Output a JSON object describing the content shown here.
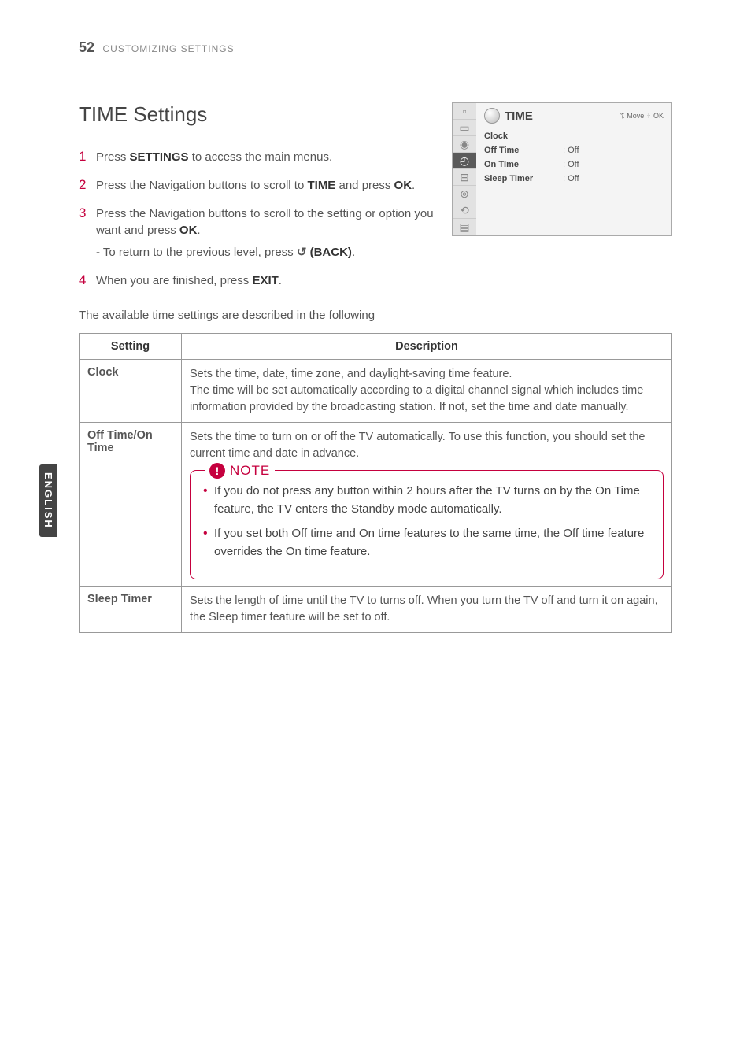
{
  "header": {
    "page_number": "52",
    "section": "CUSTOMIZING SETTINGS"
  },
  "heading": "TIME Settings",
  "steps": [
    {
      "num": "1",
      "pre": "Press ",
      "bold": "SETTINGS",
      "post": " to access the main menus."
    },
    {
      "num": "2",
      "pre": "Press the Navigation buttons to scroll to ",
      "bold": "TIME",
      "post": " and press ",
      "bold2": "OK",
      "post2": "."
    },
    {
      "num": "3",
      "pre": "Press the Navigation buttons to scroll to the setting or option you want and press ",
      "bold": "OK",
      "post": ".",
      "sub_pre": "- To return to the previous level, press ",
      "sub_icon": "↺",
      "sub_bold": " (BACK)",
      "sub_post": "."
    },
    {
      "num": "4",
      "pre": "When you are finished, press ",
      "bold": "EXIT",
      "post": "."
    }
  ],
  "intro": "The available time settings are described in the following",
  "osd": {
    "title": "TIME",
    "hint": "ꔂ Move ꔉ OK",
    "rows": [
      {
        "label": "Clock",
        "value": ""
      },
      {
        "label": "Off Time",
        "value": ": Off"
      },
      {
        "label": "On TIme",
        "value": ": Off"
      },
      {
        "label": "Sleep Timer",
        "value": ": Off"
      }
    ]
  },
  "table": {
    "headers": {
      "setting": "Setting",
      "description": "Description"
    },
    "rows": [
      {
        "label": "Clock",
        "desc": "Sets the time, date, time zone, and daylight-saving time feature.\nThe time will be set automatically according to a digital channel signal which includes time information provided by the broadcasting station. If not, set the time and date manually."
      },
      {
        "label": "Off Time/On Time",
        "desc": "Sets the time to turn on or off the TV automatically. To use this function, you should set the current time and date in advance.",
        "note_label": "NOTE",
        "notes": [
          "If you do not press any button within 2 hours after the TV turns on by the On Time feature, the TV enters the Standby mode automatically.",
          "If you set both Off time and On time features to the same time, the Off time feature overrides the On time feature."
        ]
      },
      {
        "label": "Sleep Timer",
        "desc": "Sets the length of time until the TV to turns off. When you turn the TV off and turn it on again, the Sleep timer feature will be set to off."
      }
    ]
  },
  "side_tab": "ENGLISH"
}
